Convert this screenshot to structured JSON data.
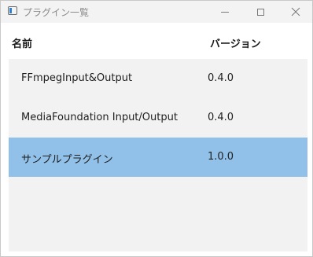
{
  "window": {
    "title": "プラグイン一覧"
  },
  "table": {
    "headers": {
      "name": "名前",
      "version": "バージョン"
    },
    "rows": [
      {
        "name": "FFmpegInput&Output",
        "version": "0.4.0",
        "selected": false
      },
      {
        "name": "MediaFoundation Input/Output",
        "version": "0.4.0",
        "selected": false
      },
      {
        "name": "サンプルプラグイン",
        "version": "1.0.0",
        "selected": true
      }
    ]
  },
  "colors": {
    "selection": "#91c0e8",
    "list_background": "#f2f2f2",
    "titlebar_background": "#f3f3f3"
  },
  "icons": {
    "app": "app-window-icon",
    "minimize": "minimize-icon",
    "maximize": "maximize-icon",
    "close": "close-icon"
  }
}
